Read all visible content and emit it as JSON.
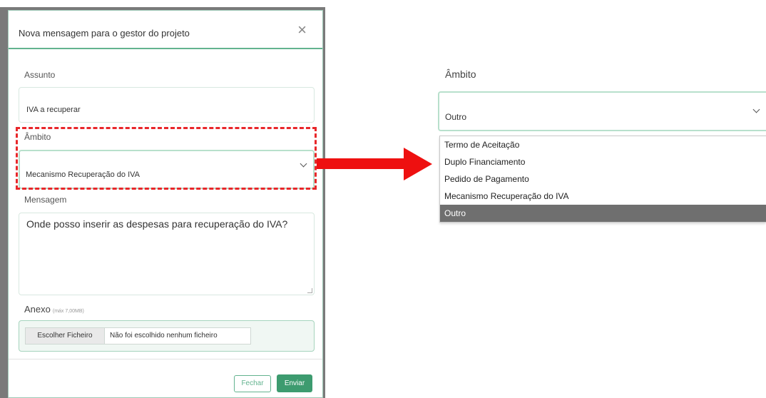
{
  "modal": {
    "title": "Nova mensagem para o gestor do projeto",
    "close_icon": "×",
    "subject_label": "Assunto",
    "subject_value": "IVA a recuperar",
    "scope_label": "Âmbito",
    "scope_value": "Mecanismo Recuperação do IVA",
    "message_label": "Mensagem",
    "message_value": "Onde posso inserir as despesas para recuperação do IVA?",
    "annex_label": "Anexo",
    "annex_note": "(máx 7,00MB)",
    "file_button": "Escolher Ficheiro",
    "file_status": "Não foi escolhido nenhum ficheiro",
    "close_button": "Fechar",
    "send_button": "Enviar"
  },
  "zoom": {
    "scope_label": "Âmbito",
    "selected_value": "Outro",
    "options": [
      "Termo de Aceitação",
      "Duplo Financiamento",
      "Pedido de Pagamento",
      "Mecanismo Recuperação do IVA",
      "Outro"
    ],
    "highlighted_option": "Outro"
  },
  "colors": {
    "accent": "#3d9b6f",
    "highlight_dash": "#e8272a",
    "arrow": "#ee1010",
    "selected_option": "#6f6f6f"
  },
  "icons": {
    "close": "close-icon",
    "chevron": "chevron-down-icon",
    "arrow": "right-arrow-icon"
  }
}
